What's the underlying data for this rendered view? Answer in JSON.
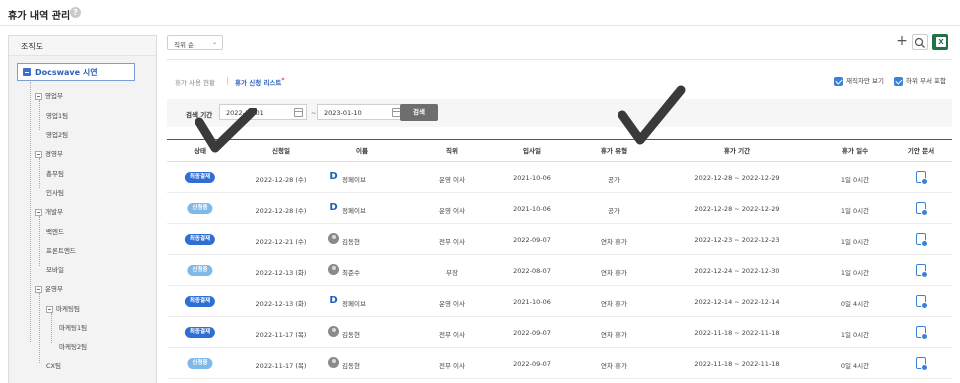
{
  "page": {
    "title": "휴가 내역 관리",
    "help": "?"
  },
  "sidebar": {
    "title": "조직도",
    "root": "Docswave 시연",
    "items": [
      "영업부",
      "영업1팀",
      "영업2팀",
      "경영부",
      "총무팀",
      "인사팀",
      "개발부",
      "백엔드",
      "프론트엔드",
      "모바일",
      "운영부",
      "마케팅팀",
      "마케팅1팀",
      "마케팅2팀",
      "CX팀"
    ]
  },
  "toolbar": {
    "sort_label": "직위 순",
    "add": "+",
    "excel": "X"
  },
  "tabs": {
    "usage": "휴가 사용 현황",
    "request": "휴가 신청 리스트",
    "request_mark": "*"
  },
  "options": {
    "resigned": "재직자만 보기",
    "sub_dept": "하위 부서 포함"
  },
  "search": {
    "label": "검색 기간",
    "start": "2022-11-01",
    "end": "2023-01-10",
    "tilde": "~",
    "button": "검색"
  },
  "table": {
    "headers": [
      "상태",
      "신청일",
      "이름",
      "직위",
      "입사일",
      "휴가 유형",
      "휴가 기간",
      "휴가 일수",
      "기안 문서"
    ],
    "rows": [
      {
        "status": "최종결재",
        "date": "2022-12-28 (수)",
        "avatar": "D",
        "name": "정페이브",
        "title": "운영 이사",
        "join": "2021-10-06",
        "type": "공가",
        "period": "2022-12-28 ~ 2022-12-29",
        "days": "1일 0시간"
      },
      {
        "status": "신청중",
        "date": "2022-12-28 (수)",
        "avatar": "D",
        "name": "정페이브",
        "title": "운영 이사",
        "join": "2021-10-06",
        "type": "공가",
        "period": "2022-12-28 ~ 2022-12-29",
        "days": "1일 0시간"
      },
      {
        "status": "최종결재",
        "date": "2022-12-21 (수)",
        "avatar": "P",
        "name": "김동현",
        "title": "전무 이사",
        "join": "2022-09-07",
        "type": "연차 휴가",
        "period": "2022-12-23 ~ 2022-12-23",
        "days": "1일 0시간"
      },
      {
        "status": "신청중",
        "date": "2022-12-13 (화)",
        "avatar": "P",
        "name": "최준수",
        "title": "부장",
        "join": "2022-08-07",
        "type": "연차 휴가",
        "period": "2022-12-24 ~ 2022-12-30",
        "days": "1일 0시간"
      },
      {
        "status": "최종결재",
        "date": "2022-12-13 (화)",
        "avatar": "D",
        "name": "정페이브",
        "title": "운영 이사",
        "join": "2021-10-06",
        "type": "연차 휴가",
        "period": "2022-12-14 ~ 2022-12-14",
        "days": "0일 4시간"
      },
      {
        "status": "최종결재",
        "date": "2022-11-17 (목)",
        "avatar": "P",
        "name": "김동현",
        "title": "전무 이사",
        "join": "2022-09-07",
        "type": "연차 휴가",
        "period": "2022-11-18 ~ 2022-11-18",
        "days": "1일 0시간"
      },
      {
        "status": "신청중",
        "date": "2022-11-17 (목)",
        "avatar": "P",
        "name": "김동현",
        "title": "전무 이사",
        "join": "2022-09-07",
        "type": "연차 휴가",
        "period": "2022-11-18 ~ 2022-11-18",
        "days": "0일 4시간"
      }
    ]
  },
  "colors": {
    "accent": "#2f6fd4",
    "applied": "#7fb9ea",
    "excel": "#217346"
  }
}
